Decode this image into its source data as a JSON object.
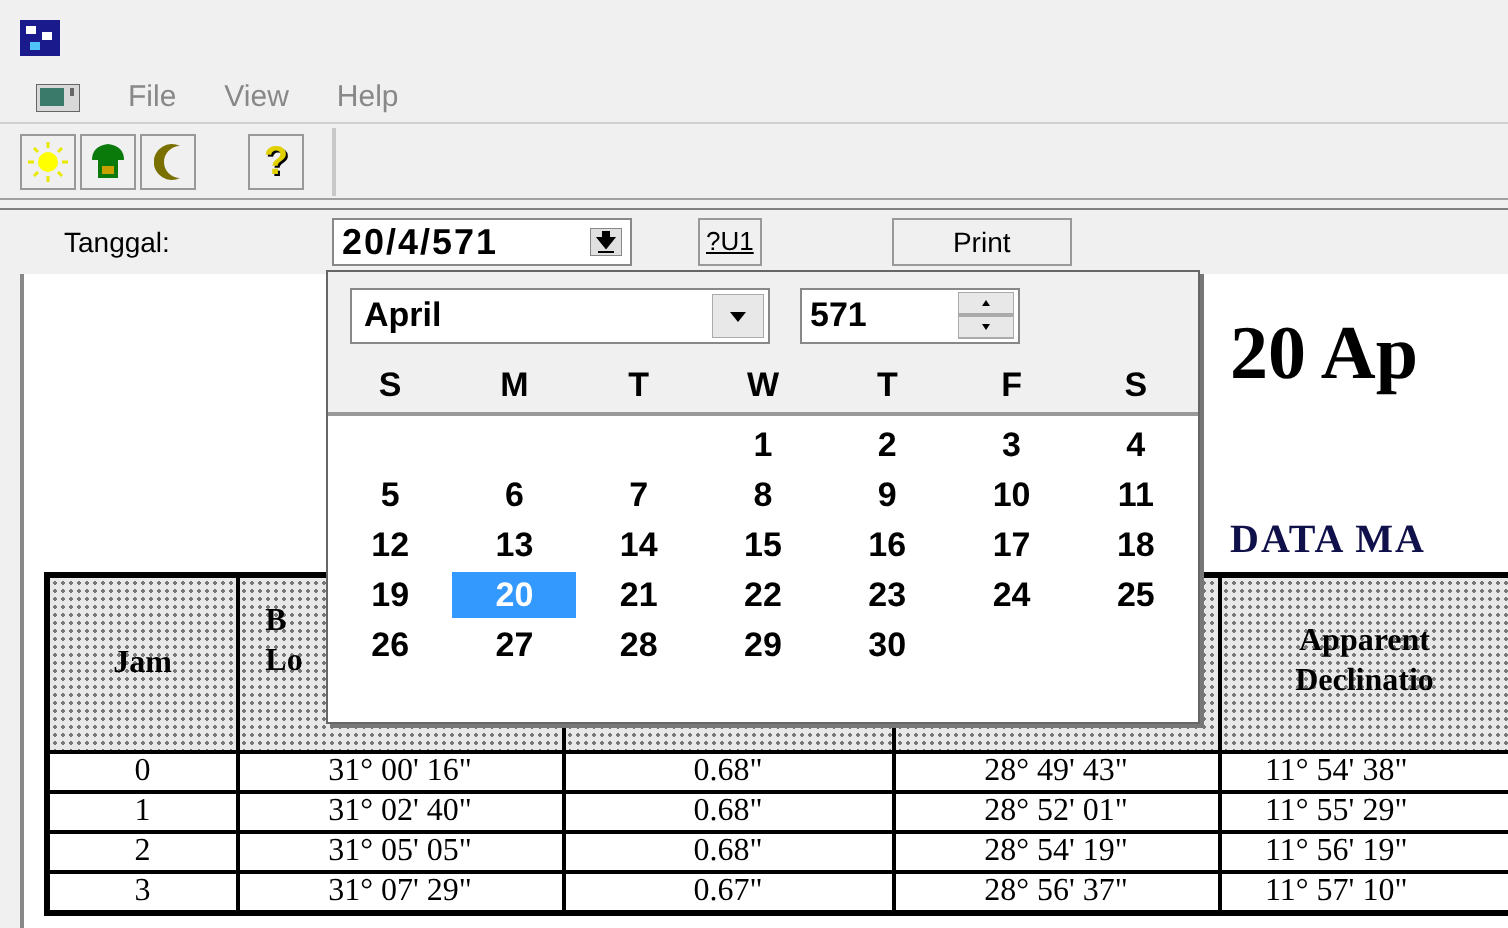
{
  "menu": [
    "File",
    "View",
    "Help"
  ],
  "toolbar": [
    {
      "kind": "sun"
    },
    {
      "kind": "mosque"
    },
    {
      "kind": "moon"
    },
    {
      "kind": "help",
      "glyph": "?"
    }
  ],
  "date_bar": {
    "label": "Tanggal:",
    "value": "20/4/571",
    "buttons": [
      "?U1",
      "Print"
    ]
  },
  "calendar": {
    "month": "April",
    "year": "571",
    "weekdays": [
      "S",
      "M",
      "T",
      "W",
      "T",
      "F",
      "S"
    ],
    "days": [
      {
        "kind": "blank"
      },
      {
        "kind": "blank"
      },
      {
        "kind": "blank"
      },
      {
        "kind": "day",
        "label": "1",
        "selected": false
      },
      {
        "kind": "day",
        "label": "2",
        "selected": false
      },
      {
        "kind": "day",
        "label": "3",
        "selected": false
      },
      {
        "kind": "day",
        "label": "4",
        "selected": false
      },
      {
        "kind": "day",
        "label": "5",
        "selected": false
      },
      {
        "kind": "day",
        "label": "6",
        "selected": false
      },
      {
        "kind": "day",
        "label": "7",
        "selected": false
      },
      {
        "kind": "day",
        "label": "8",
        "selected": false
      },
      {
        "kind": "day",
        "label": "9",
        "selected": false
      },
      {
        "kind": "day",
        "label": "10",
        "selected": false
      },
      {
        "kind": "day",
        "label": "11",
        "selected": false
      },
      {
        "kind": "day",
        "label": "12",
        "selected": false
      },
      {
        "kind": "day",
        "label": "13",
        "selected": false
      },
      {
        "kind": "day",
        "label": "14",
        "selected": false
      },
      {
        "kind": "day",
        "label": "15",
        "selected": false
      },
      {
        "kind": "day",
        "label": "16",
        "selected": false
      },
      {
        "kind": "day",
        "label": "17",
        "selected": false
      },
      {
        "kind": "day",
        "label": "18",
        "selected": false
      },
      {
        "kind": "day",
        "label": "19",
        "selected": false
      },
      {
        "kind": "day",
        "label": "20",
        "selected": true
      },
      {
        "kind": "day",
        "label": "21",
        "selected": false
      },
      {
        "kind": "day",
        "label": "22",
        "selected": false
      },
      {
        "kind": "day",
        "label": "23",
        "selected": false
      },
      {
        "kind": "day",
        "label": "24",
        "selected": false
      },
      {
        "kind": "day",
        "label": "25",
        "selected": false
      },
      {
        "kind": "day",
        "label": "26",
        "selected": false
      },
      {
        "kind": "day",
        "label": "27",
        "selected": false
      },
      {
        "kind": "day",
        "label": "28",
        "selected": false
      },
      {
        "kind": "day",
        "label": "29",
        "selected": false
      },
      {
        "kind": "day",
        "label": "30",
        "selected": false
      }
    ]
  },
  "report": {
    "heading": "20 Ap",
    "subheading": "DATA MA",
    "table": {
      "columns": [
        {
          "kind": "text",
          "lines": [
            "Jam"
          ]
        },
        {
          "kind": "partial",
          "lines": [
            "B",
            "Lo"
          ]
        },
        {
          "kind": "hidden"
        },
        {
          "kind": "hidden"
        },
        {
          "kind": "text",
          "lines": [
            "Apparent",
            "Declinatio"
          ]
        }
      ],
      "rows": [
        [
          "0",
          "31° 00' 16\"",
          "0.68\"",
          "28° 49' 43\"",
          "11° 54' 38\""
        ],
        [
          "1",
          "31° 02' 40\"",
          "0.68\"",
          "28° 52' 01\"",
          "11° 55' 29\""
        ],
        [
          "2",
          "31° 05' 05\"",
          "0.68\"",
          "28° 54' 19\"",
          "11° 56' 19\""
        ],
        [
          "3",
          "31° 07' 29\"",
          "0.67\"",
          "28° 56' 37\"",
          "11° 57' 10\""
        ]
      ]
    }
  }
}
